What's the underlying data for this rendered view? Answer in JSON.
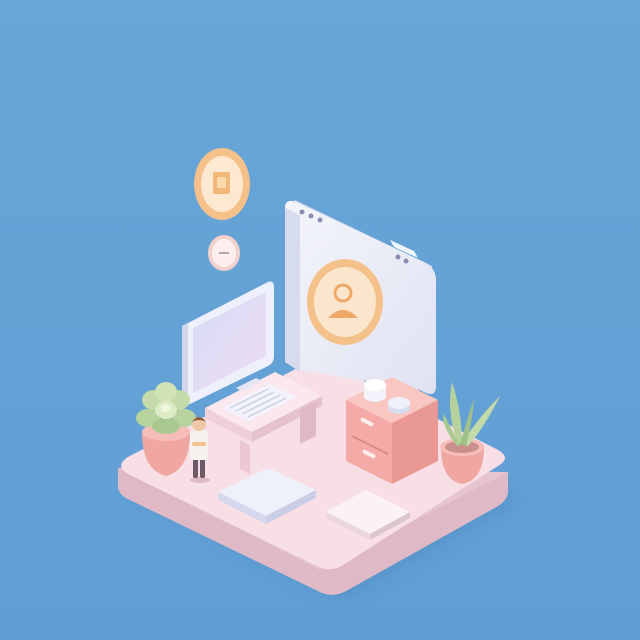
{
  "scene": {
    "kind": "isometric-3d-illustration",
    "subject": "workspace-on-floating-platform",
    "elements": [
      "platform",
      "back-panel-window",
      "avatar-badge",
      "floating-bubbles",
      "computer-monitor",
      "desk",
      "keyboard",
      "succulent-pot",
      "tall-plant-pot",
      "cabinet",
      "jars",
      "mini-figure",
      "floor-tiles"
    ]
  },
  "colors": {
    "background": "#6aa3d3",
    "platform_top": "#f7dde4",
    "platform_side": "#e7c7d0",
    "panel": "#eef0f8",
    "accent_orange": "#f3c189",
    "cabinet": "#f4a9a8",
    "plant_green": "#aac894",
    "pot": "#f0a7a2"
  }
}
